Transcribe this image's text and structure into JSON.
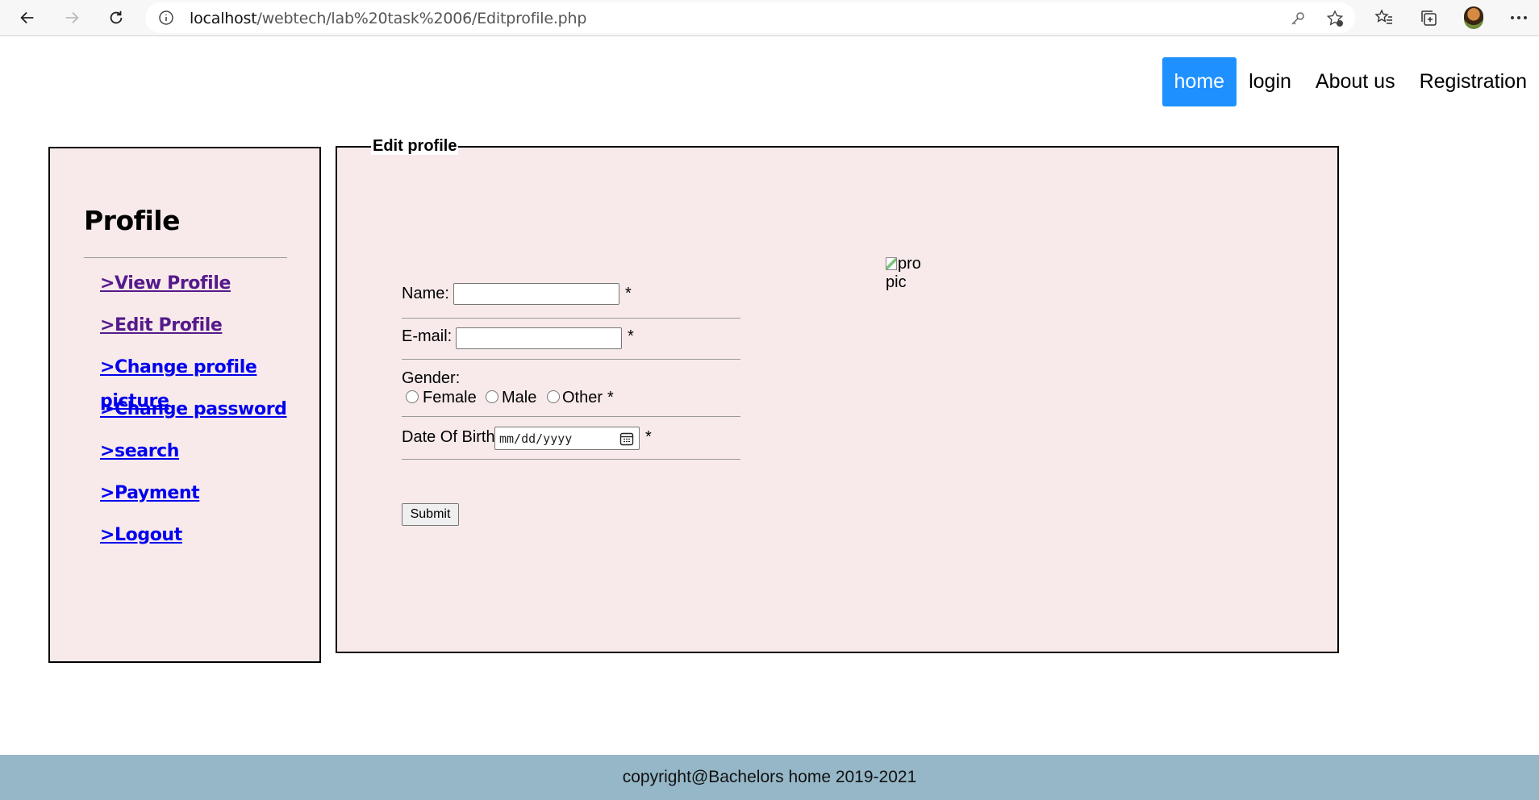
{
  "browser": {
    "url_host": "localhost",
    "url_path": "/webtech/lab%20task%2006/Editprofile.php"
  },
  "nav": {
    "items": [
      {
        "label": "home",
        "active": true
      },
      {
        "label": "login",
        "active": false
      },
      {
        "label": "About us",
        "active": false
      },
      {
        "label": "Registration",
        "active": false
      }
    ]
  },
  "sidebar": {
    "title": "Profile",
    "links": [
      {
        "label": ">View Profile",
        "visited": true
      },
      {
        "label": ">Edit Profile",
        "visited": true
      },
      {
        "label": ">Change profile picture",
        "visited": false
      },
      {
        "label": ">Change password",
        "visited": false
      },
      {
        "label": ">search",
        "visited": false
      },
      {
        "label": ">Payment",
        "visited": false
      },
      {
        "label": ">Logout",
        "visited": false
      }
    ]
  },
  "form": {
    "legend": "Edit profile",
    "name_label": "Name:",
    "name_value": "",
    "email_label": "E-mail:",
    "email_value": "",
    "gender_label": "Gender:",
    "gender_options": [
      "Female",
      "Male",
      "Other"
    ],
    "dob_label": "Date Of Birth",
    "dob_placeholder": "mm/dd/yyyy",
    "required_mark": "*",
    "submit_label": "Submit",
    "image_alt": "pro pic"
  },
  "footer": {
    "text": "copyright@Bachelors home 2019-2021"
  },
  "colors": {
    "nav_active": "#1e90ff",
    "panel_bg": "#f8eaea",
    "footer_bg": "#95b7c7",
    "link": "#0000ee",
    "link_visited": "#551a8b"
  }
}
